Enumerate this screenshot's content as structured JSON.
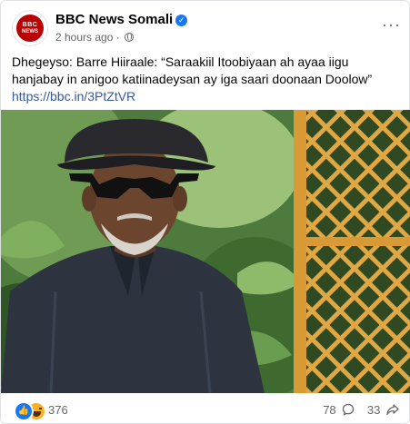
{
  "post": {
    "page_name": "BBC News Somali",
    "timestamp": "2 hours ago",
    "separator": "·",
    "avatar_logo_top": "BBC",
    "avatar_logo_bottom": "NEWS",
    "text": "Dhegeyso: Barre Hiiraale: “Saraakiil Itoobiyaan ah ayaa iigu hanjabay in anigoo katiinadeysan ay iga saari doonaan Doolow”",
    "link": "https://bbc.in/3PtZtVR",
    "more_label": "···"
  },
  "footer": {
    "reaction_count": "376",
    "comment_count": "78",
    "share_count": "33"
  },
  "icons": {
    "verified": "verified-check-icon",
    "privacy": "globe-icon",
    "more": "more-options-icon",
    "like": "like-reaction-icon",
    "haha": "haha-reaction-icon",
    "comment": "comment-icon",
    "share": "share-icon"
  },
  "colors": {
    "brand_blue": "#1877f2",
    "bbc_red": "#b80000",
    "link": "#385898",
    "secondary_text": "#65676b"
  }
}
